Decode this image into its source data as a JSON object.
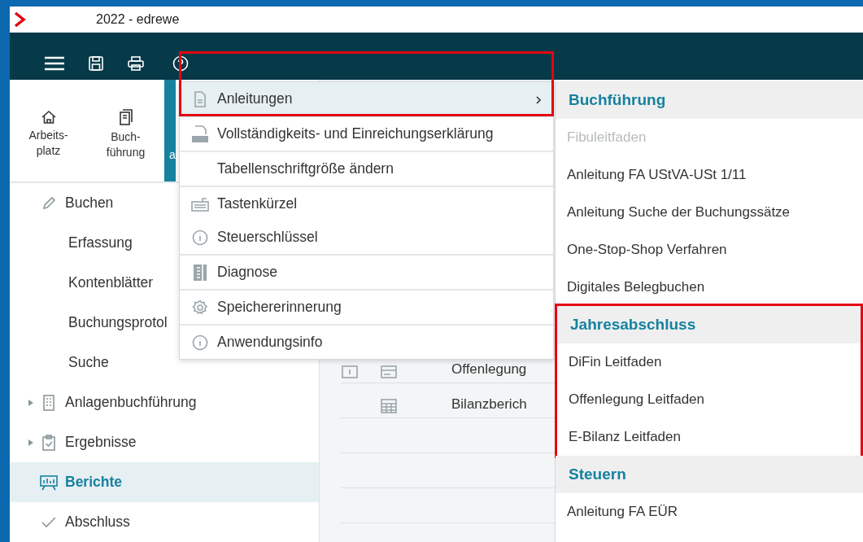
{
  "window": {
    "title": "2022 - edrewe"
  },
  "side_tabs": [
    {
      "label": "Arbeits-\nplatz",
      "selected": false
    },
    {
      "label": "Buch-\nführung",
      "selected": false
    },
    {
      "label": "a",
      "selected": true
    }
  ],
  "tree": [
    {
      "label": "Buchen",
      "collapsed": false,
      "selected": false,
      "children": [
        {
          "label": "Erfassung",
          "selected": false
        },
        {
          "label": "Kontenblätter",
          "selected": false
        },
        {
          "label": "Buchungsprotol",
          "selected": false
        },
        {
          "label": "Suche",
          "selected": false
        }
      ]
    },
    {
      "label": "Anlagenbuchführung",
      "collapsed": true,
      "selected": false
    },
    {
      "label": "Ergebnisse",
      "collapsed": true,
      "selected": false
    },
    {
      "label": "Berichte",
      "collapsed": false,
      "selected": true
    },
    {
      "label": "Abschluss",
      "collapsed": false,
      "selected": false
    }
  ],
  "report_rows": [
    {
      "label": "Offenlegung"
    },
    {
      "label": "Bilanzberich"
    },
    {
      "label": ""
    },
    {
      "label": ""
    },
    {
      "label": ""
    }
  ],
  "help_menu": {
    "highlighted": true,
    "groups": [
      [
        {
          "label": "Anleitungen",
          "selected": true,
          "submenu": true
        }
      ],
      [
        {
          "label": "Vollständigkeits- und Einreichungserklärung",
          "selected": false,
          "submenu": false
        }
      ],
      [
        {
          "label": "Tabellenschriftgröße ändern",
          "selected": false,
          "submenu": false
        }
      ],
      [
        {
          "label": "Tastenkürzel",
          "selected": false,
          "submenu": false
        },
        {
          "label": "Steuerschlüssel",
          "selected": false,
          "submenu": false
        }
      ],
      [
        {
          "label": "Diagnose",
          "selected": false,
          "submenu": false
        }
      ],
      [
        {
          "label": "Speichererinnerung",
          "selected": false,
          "submenu": false
        }
      ],
      [
        {
          "label": "Anwendungsinfo",
          "selected": false,
          "submenu": false
        }
      ]
    ]
  },
  "submenu": {
    "sections": [
      {
        "title": "Buchführung",
        "highlighted": false,
        "items": [
          {
            "label": "Fibuleitfaden",
            "disabled": true
          },
          {
            "label": "Anleitung FA UStVA-USt 1/11",
            "disabled": false
          },
          {
            "label": "Anleitung Suche der Buchungssätze",
            "disabled": false
          },
          {
            "label": "One-Stop-Shop Verfahren",
            "disabled": false
          },
          {
            "label": "Digitales Belegbuchen",
            "disabled": false
          }
        ]
      },
      {
        "title": "Jahresabschluss",
        "highlighted": true,
        "items": [
          {
            "label": "DiFin Leitfaden",
            "disabled": false
          },
          {
            "label": "Offenlegung Leitfaden",
            "disabled": false
          },
          {
            "label": "E-Bilanz Leitfaden",
            "disabled": false
          }
        ]
      },
      {
        "title": "Steuern",
        "highlighted": false,
        "items": [
          {
            "label": "Anleitung FA EÜR",
            "disabled": false
          }
        ]
      }
    ]
  }
}
